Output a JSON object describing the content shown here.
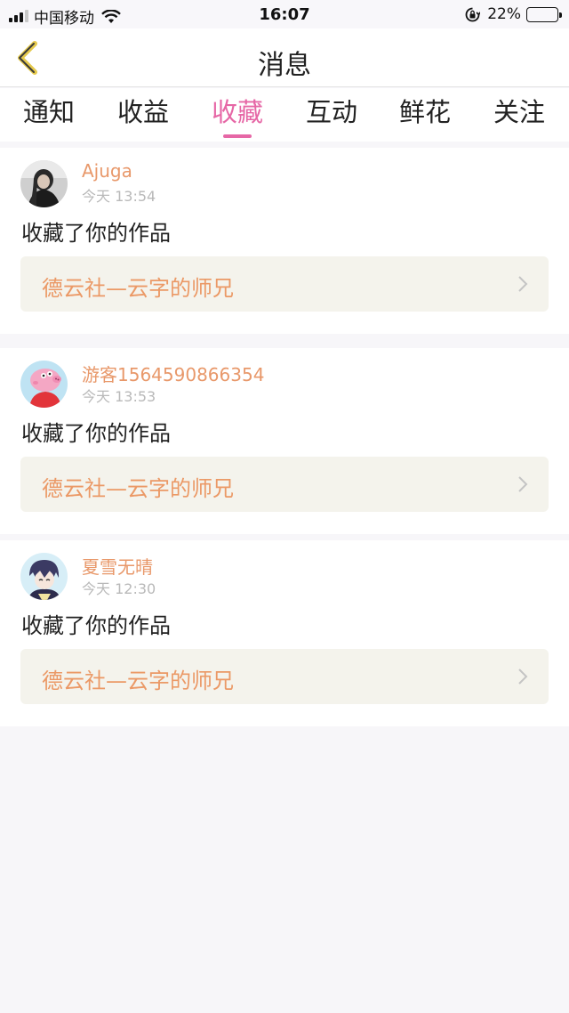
{
  "status_bar": {
    "carrier": "中国移动",
    "time": "16:07",
    "battery_percent": "22%",
    "battery_level": 0.22
  },
  "header": {
    "title": "消息",
    "back_icon": "chevron-left-icon"
  },
  "tabs": [
    {
      "label": "通知",
      "active": false
    },
    {
      "label": "收益",
      "active": false
    },
    {
      "label": "收藏",
      "active": true
    },
    {
      "label": "互动",
      "active": false
    },
    {
      "label": "鲜花",
      "active": false
    },
    {
      "label": "关注",
      "active": false
    }
  ],
  "colors": {
    "accent_pink": "#e667a6",
    "username_orange": "#e8986a",
    "work_title_orange": "#eb9966"
  },
  "notifications": [
    {
      "username": "Ajuga",
      "time": "今天 13:54",
      "action": "收藏了你的作品",
      "work_title": "德云社—云字的师兄"
    },
    {
      "username": "游客1564590866354",
      "time": "今天 13:53",
      "action": "收藏了你的作品",
      "work_title": "德云社—云字的师兄"
    },
    {
      "username": "夏雪无晴",
      "time": "今天 12:30",
      "action": "收藏了你的作品",
      "work_title": "德云社—云字的师兄"
    }
  ]
}
